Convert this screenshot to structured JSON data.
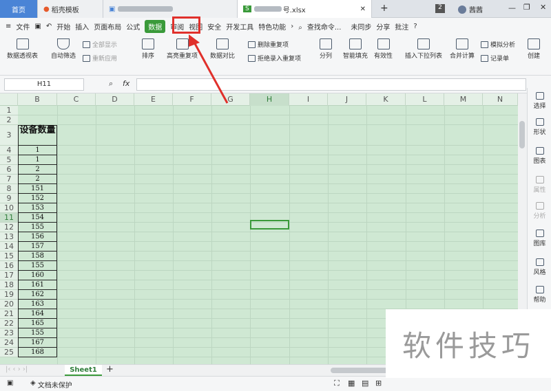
{
  "tabs": {
    "home": "首页",
    "template": "稻壳模板",
    "active_file": "号.xlsx",
    "count": "2",
    "user": "茜茜"
  },
  "menu": {
    "file": "文件",
    "start": "开始",
    "insert": "插入",
    "layout": "页面布局",
    "formula": "公式",
    "data": "数据",
    "review": "审阅",
    "view": "视图",
    "security": "安全",
    "dev": "开发工具",
    "special": "特色功能",
    "search": "查找命令...",
    "sync": "未同步",
    "share": "分享",
    "comment": "批注",
    "help": "?"
  },
  "ribbon": {
    "pivot": "数据透视表",
    "autofilter": "自动筛选",
    "show_all": "全部显示",
    "reapply": "重新应用",
    "sort": "排序",
    "highlight_dup": "高亮重复项",
    "compare": "数据对比",
    "remove_dup": "删除重复项",
    "reject_dup": "拒绝录入重复项",
    "split": "分列",
    "smart_fill": "智能填充",
    "validity": "有效性",
    "dropdown": "插入下拉列表",
    "consolidate": "合并计算",
    "simulate": "模拟分析",
    "record": "记录单",
    "create": "创建"
  },
  "formula_bar": {
    "name_box": "H11",
    "fx": "fx"
  },
  "columns": [
    "B",
    "C",
    "D",
    "E",
    "F",
    "G",
    "H",
    "I",
    "J",
    "K",
    "L",
    "M",
    "N"
  ],
  "rows": [
    "1",
    "2",
    "3",
    "4",
    "5",
    "6",
    "7",
    "8",
    "9",
    "10",
    "11",
    "12",
    "13",
    "14",
    "15",
    "16",
    "17",
    "18",
    "19",
    "20",
    "21",
    "22",
    "23",
    "24",
    "25"
  ],
  "cells": {
    "header": "设备数量",
    "values": [
      "1",
      "1",
      "2",
      "2",
      "151",
      "152",
      "153",
      "154",
      "155",
      "156",
      "157",
      "158",
      "155",
      "160",
      "161",
      "162",
      "163",
      "164",
      "165",
      "155",
      "167",
      "168"
    ]
  },
  "right_panel": [
    "选择",
    "形状",
    "图表",
    "属性",
    "分析",
    "图库",
    "风格",
    "帮助"
  ],
  "sheet_tab": "Sheet1",
  "status": {
    "protect": "文档未保护"
  },
  "watermark": "软件技巧"
}
